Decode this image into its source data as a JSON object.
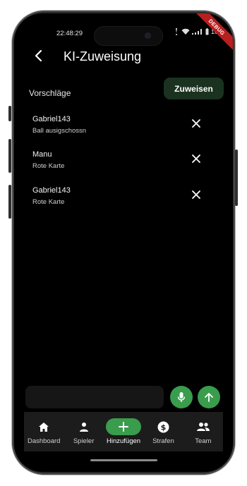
{
  "status": {
    "time": "22:48:29",
    "battery": "100"
  },
  "debug_banner": "DEBUG",
  "appbar": {
    "title": "KI-Zuweisung",
    "back_icon": "arrow-back-icon"
  },
  "suggestions": {
    "label": "Vorschläge",
    "assign_button": "Zuweisen",
    "items": [
      {
        "name": "Gabriel143",
        "detail": "Ball ausigschossn"
      },
      {
        "name": "Manu",
        "detail": "Rote Karte"
      },
      {
        "name": "Gabriel143",
        "detail": "Rote Karte"
      }
    ]
  },
  "input": {
    "value": "",
    "placeholder": ""
  },
  "nav": {
    "items": [
      {
        "label": "Dashboard",
        "icon": "home-icon"
      },
      {
        "label": "Spieler",
        "icon": "person-icon"
      },
      {
        "label": "Hinzufügen",
        "icon": "plus-icon",
        "active": true
      },
      {
        "label": "Strafen",
        "icon": "dollar-coin-icon"
      },
      {
        "label": "Team",
        "icon": "group-icon"
      }
    ]
  },
  "colors": {
    "accent": "#3a9c4d",
    "assign_button_bg": "#1b3221",
    "background": "#000000"
  }
}
